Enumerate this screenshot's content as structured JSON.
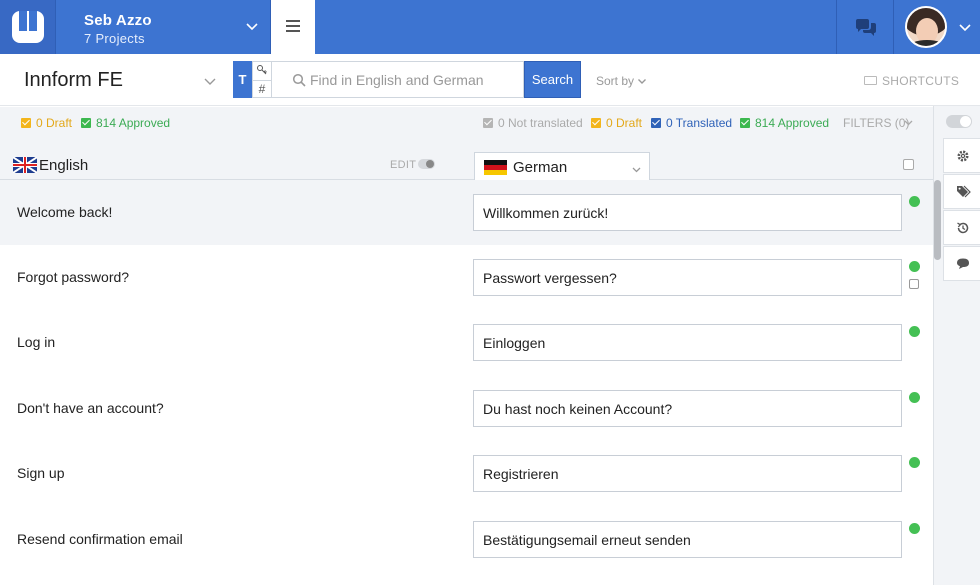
{
  "header": {
    "user_name": "Seb Azzo",
    "projects_label": "7 Projects"
  },
  "toolbar": {
    "project_name": "Innform FE",
    "mode_text": "T",
    "mode_key": "#",
    "search_placeholder": "Find in English and German",
    "search_value": "",
    "search_button": "Search",
    "sort_label": "Sort by",
    "shortcuts_label": "SHORTCUTS"
  },
  "source_stats": {
    "draft": "0 Draft",
    "approved": "814 Approved"
  },
  "target_stats": {
    "not_translated": "0 Not translated",
    "draft": "0 Draft",
    "translated": "0 Translated",
    "approved": "814 Approved",
    "filters": "FILTERS (0)"
  },
  "languages": {
    "source": "English",
    "edit_label": "EDIT",
    "target": "German"
  },
  "rows": [
    {
      "source": "Welcome back!",
      "target": "Willkommen zurück!",
      "status": "approved"
    },
    {
      "source": "Forgot password?",
      "target": "Passwort vergessen?",
      "status": "approved"
    },
    {
      "source": "Log in",
      "target": "Einloggen",
      "status": "approved"
    },
    {
      "source": "Don't have an account?",
      "target": "Du hast noch keinen Account?",
      "status": "approved"
    },
    {
      "source": "Sign up",
      "target": "Registrieren",
      "status": "approved"
    },
    {
      "source": "Resend confirmation email",
      "target": "Bestätigungsemail erneut senden",
      "status": "approved"
    }
  ],
  "colors": {
    "brand": "#3d74d1",
    "approved": "#3cb84f",
    "draft": "#f3b51b",
    "translated": "#2f62b8"
  },
  "icons": {
    "logo": "innform-u-logo",
    "menu": "hamburger-icon",
    "chat": "chat-bubbles-icon",
    "settings": "gear-icon",
    "tags": "tags-icon",
    "history": "history-icon",
    "comments": "comment-icon"
  }
}
